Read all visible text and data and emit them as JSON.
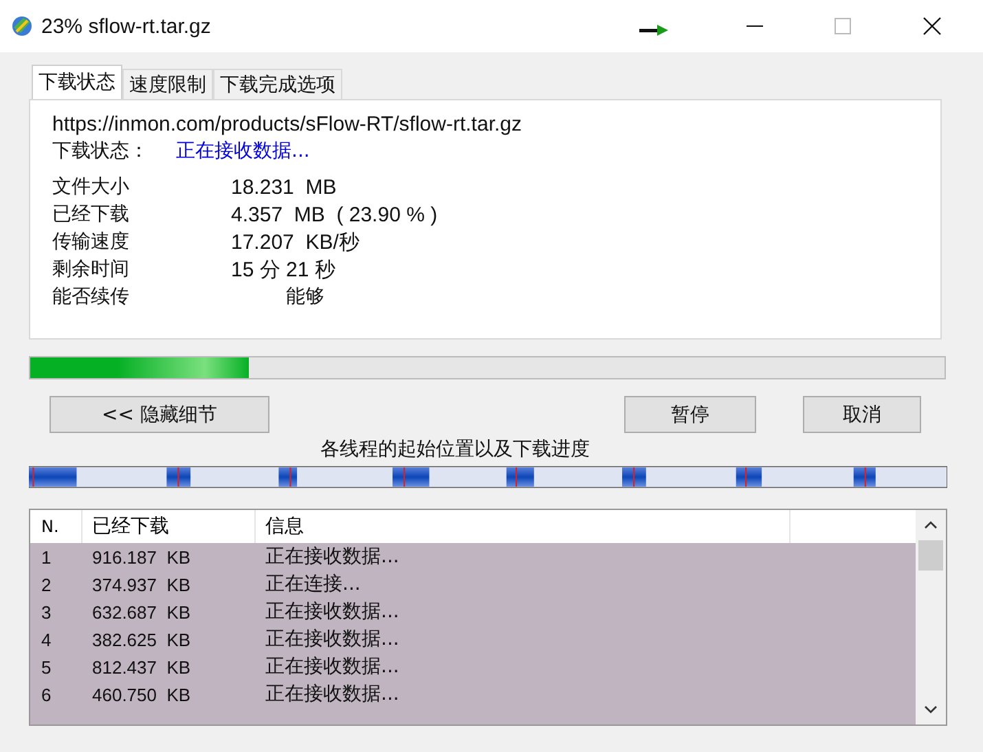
{
  "window": {
    "title": "23% sflow-rt.tar.gz"
  },
  "tabs": [
    {
      "label": "下载状态",
      "selected": true
    },
    {
      "label": "速度限制",
      "selected": false
    },
    {
      "label": "下载完成选项",
      "selected": false
    }
  ],
  "url": "https://inmon.com/products/sFlow-RT/sflow-rt.tar.gz",
  "status": {
    "label": "下载状态：",
    "value": "正在接收数据..."
  },
  "details": [
    {
      "label": "文件大小",
      "value": "18.231  MB"
    },
    {
      "label": "已经下载",
      "value": "4.357  MB  ( 23.90 % )"
    },
    {
      "label": "传输速度",
      "value": "17.207  KB/秒"
    },
    {
      "label": "剩余时间",
      "value": "15 分 21 秒"
    },
    {
      "label": "能否续传",
      "value": "能够",
      "indent": true
    }
  ],
  "progress": {
    "level": 0.239
  },
  "buttons": {
    "details": "<< 隐藏细节",
    "pause": "暂停",
    "cancel": "取消"
  },
  "threads_caption": "各线程的起始位置以及下载进度",
  "table": {
    "columns": [
      "N.",
      "已经下载",
      "信息"
    ],
    "rows": [
      {
        "n": "1",
        "downloaded": "916.187  KB",
        "info": "正在接收数据..."
      },
      {
        "n": "2",
        "downloaded": "374.937  KB",
        "info": "正在连接..."
      },
      {
        "n": "3",
        "downloaded": "632.687  KB",
        "info": "正在接收数据..."
      },
      {
        "n": "4",
        "downloaded": "382.625  KB",
        "info": "正在接收数据..."
      },
      {
        "n": "5",
        "downloaded": "812.437  KB",
        "info": "正在接收数据..."
      },
      {
        "n": "6",
        "downloaded": "460.750  KB",
        "info": "正在接收数据..."
      }
    ]
  }
}
